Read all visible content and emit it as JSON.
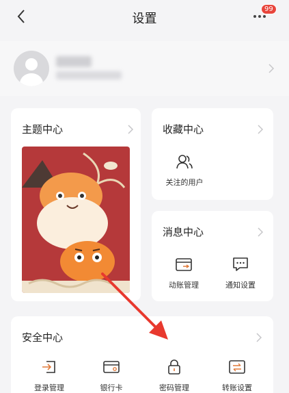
{
  "header": {
    "title": "设置",
    "badge_count": "99",
    "icons": [
      "chevron-left-icon",
      "more-icon"
    ]
  },
  "profile": {
    "avatar_icon": "default-user-avatar"
  },
  "theme_center": {
    "title": "主题中心"
  },
  "favorites_center": {
    "title": "收藏中心",
    "items": [
      {
        "label": "关注的用户",
        "icon": "followed-users-icon"
      }
    ]
  },
  "message_center": {
    "title": "消息中心",
    "items": [
      {
        "label": "动账管理",
        "icon": "account-activity-icon"
      },
      {
        "label": "通知设置",
        "icon": "notification-bubble-icon"
      }
    ]
  },
  "security_center": {
    "title": "安全中心",
    "items": [
      {
        "label": "登录管理",
        "icon": "login-icon"
      },
      {
        "label": "银行卡",
        "icon": "bank-card-icon"
      },
      {
        "label": "密码管理",
        "icon": "lock-icon"
      },
      {
        "label": "转账设置",
        "icon": "transfer-icon"
      }
    ]
  },
  "colors": {
    "background": "#f4f4f6",
    "card": "#ffffff",
    "badge": "#e8453c",
    "annotation_arrow": "#e8392e",
    "theme_red": "#b5393a"
  }
}
